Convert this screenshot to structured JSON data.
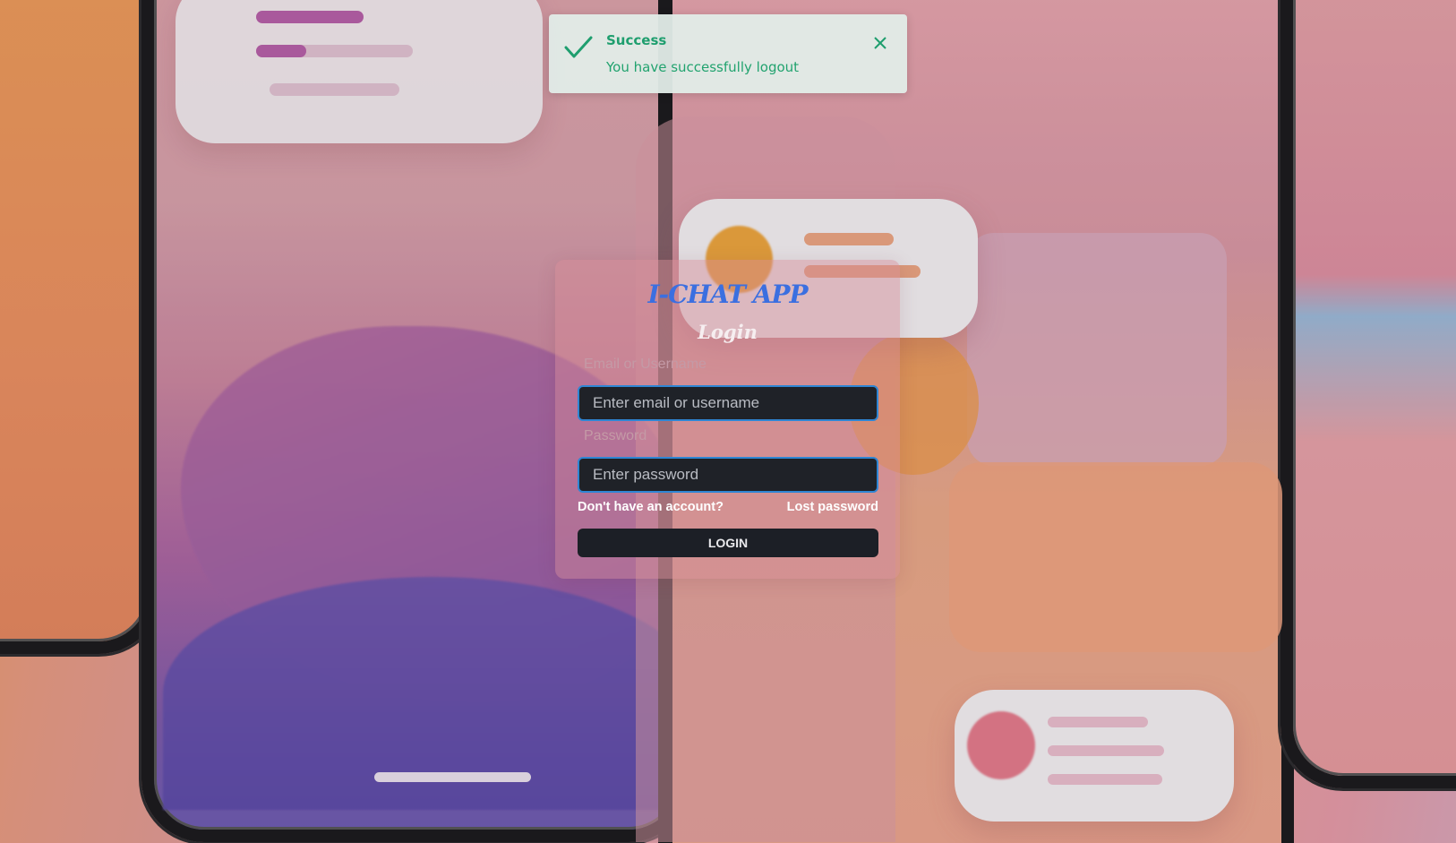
{
  "toast": {
    "title": "Success",
    "message": "You have successfully logout",
    "status_color": "#1e9e6e"
  },
  "login": {
    "app_title": "I-CHAT APP",
    "heading": "Login",
    "email_label": "Email or Username",
    "email_placeholder": "Enter email or username",
    "email_value": "",
    "password_label": "Password",
    "password_placeholder": "Enter password",
    "password_value": "",
    "signup_link": "Don't have an account?",
    "lost_password_link": "Lost password",
    "submit_label": "LOGIN",
    "accent_color": "#3b6fe0"
  },
  "icons": {
    "toast_status": "check-icon",
    "toast_dismiss": "close-icon"
  }
}
